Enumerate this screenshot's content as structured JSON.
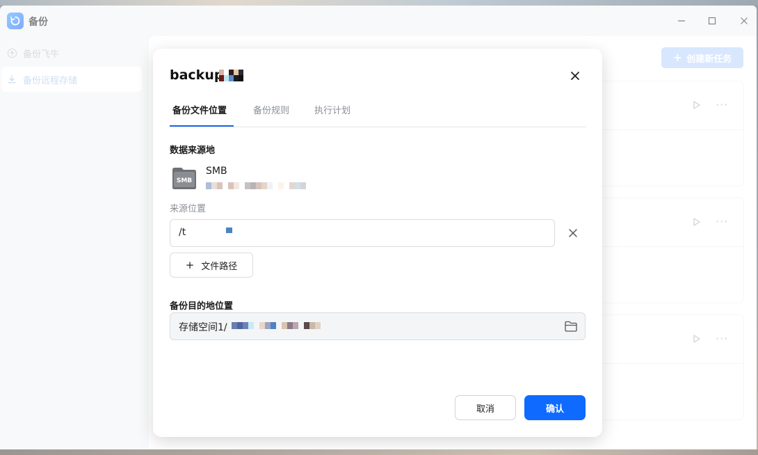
{
  "app": {
    "title": "备份",
    "icon": "backup-app-icon"
  },
  "window_controls": {
    "minimize": "minimize-icon",
    "maximize": "maximize-icon",
    "close": "close-icon"
  },
  "sidebar": {
    "items": [
      {
        "label": "备份飞牛",
        "icon": "cloud-upload-icon"
      },
      {
        "label": "备份远程存储",
        "icon": "download-icon",
        "selected": true
      }
    ]
  },
  "main": {
    "create_button": "创建新任务",
    "cards": [
      {
        "play": "play-icon",
        "more": "···"
      },
      {
        "play": "play-icon",
        "more": "···"
      },
      {
        "play": "play-icon",
        "more": "···"
      }
    ]
  },
  "dialog": {
    "title": "backup",
    "tabs": [
      {
        "label": "备份文件位置",
        "active": true
      },
      {
        "label": "备份规则"
      },
      {
        "label": "执行计划"
      }
    ],
    "source": {
      "section_label": "数据来源地",
      "type": "SMB",
      "icon_text": "SMB",
      "location_label": "来源位置",
      "path_value": "/t",
      "add_path_label": "文件路径"
    },
    "destination": {
      "section_label": "备份目的地位置",
      "path_value": "存储空间1/"
    },
    "buttons": {
      "cancel": "取消",
      "confirm": "确认"
    }
  },
  "colors": {
    "primary": "#0f6bff",
    "accent_light": "#b9d4fb",
    "text": "#1a1a1a",
    "muted": "#8a8f96"
  }
}
